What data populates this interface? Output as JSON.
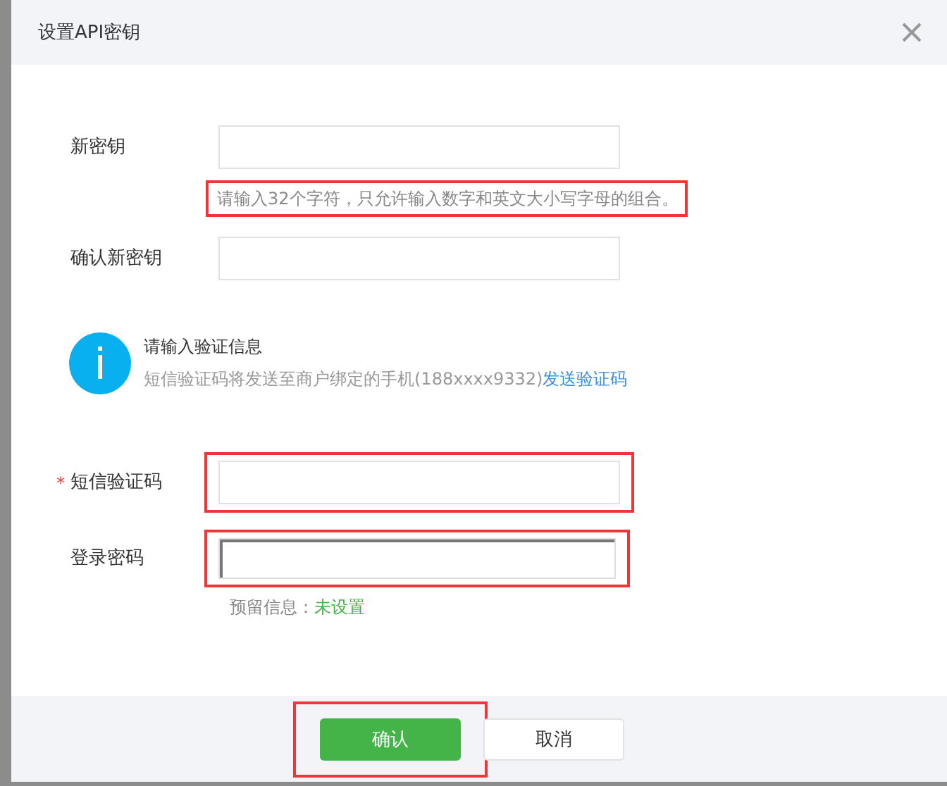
{
  "dialog": {
    "title": "设置API密钥"
  },
  "key_fields": [
    {
      "label": "新密钥",
      "highlighted": false,
      "focused": false,
      "hint": {
        "text": "请输入32个字符，只允许输入数字和英文大小写字母的组合。",
        "highlighted": true
      }
    },
    {
      "label": "确认新密钥",
      "highlighted": false,
      "focused": false
    }
  ],
  "notice": {
    "title": "请输入验证信息",
    "text": "短信验证码将发送至商户绑定的手机(188xxxx9332)",
    "link": "发送验证码"
  },
  "verify_fields": [
    {
      "label": "短信验证码",
      "required_mark": "*",
      "highlighted": true,
      "focused": false
    },
    {
      "label": "登录密码",
      "highlighted": true,
      "focused": true,
      "note": {
        "label": "预留信息：",
        "value": "未设置"
      }
    }
  ],
  "buttons": [
    {
      "label": "确认",
      "kind": "primary",
      "highlighted": true
    },
    {
      "label": "取消",
      "kind": "secondary",
      "highlighted": false
    }
  ]
}
